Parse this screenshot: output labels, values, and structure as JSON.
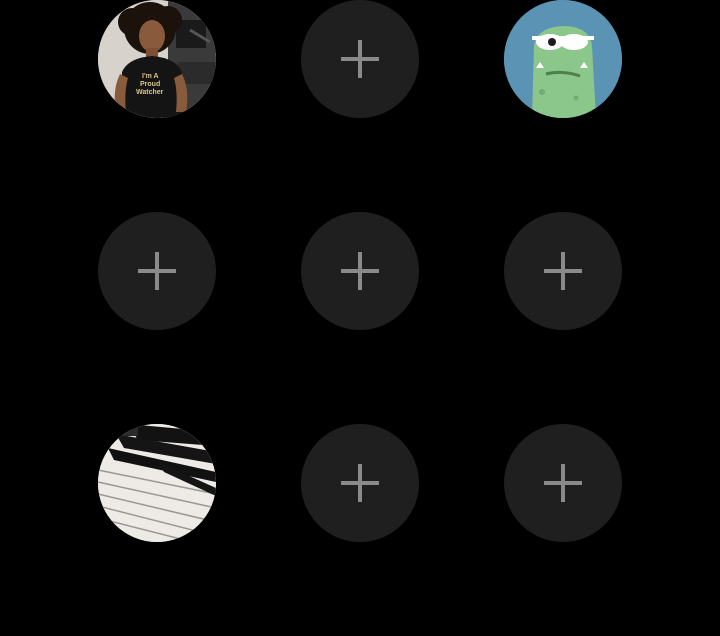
{
  "screen": {
    "background": "#000000"
  },
  "shortcut_grid": {
    "empty_slot_color": "#1f1f1f",
    "plus_color": "#8a8a8a",
    "slots": [
      {
        "kind": "photo",
        "subject": "person-in-studio",
        "shirt_text": "I'm A Proud Watcher"
      },
      {
        "kind": "empty",
        "icon": "plus-icon"
      },
      {
        "kind": "photo",
        "subject": "green-cartoon-creature"
      },
      {
        "kind": "empty",
        "icon": "plus-icon"
      },
      {
        "kind": "empty",
        "icon": "plus-icon"
      },
      {
        "kind": "empty",
        "icon": "plus-icon"
      },
      {
        "kind": "photo",
        "subject": "piano-keys"
      },
      {
        "kind": "empty",
        "icon": "plus-icon"
      },
      {
        "kind": "empty",
        "icon": "plus-icon"
      }
    ]
  }
}
